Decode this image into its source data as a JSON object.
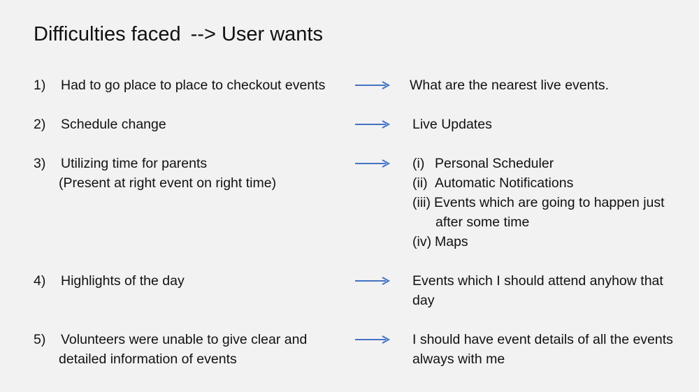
{
  "slide": {
    "title_left": "Difficulties faced",
    "title_arrow": "-->",
    "title_right": "User wants",
    "accent_color": "#4472c4",
    "rows": [
      {
        "num": "1)",
        "left": [
          "Had to go place to place to checkout events"
        ],
        "right": [
          "What are the nearest live events."
        ]
      },
      {
        "num": "2)",
        "left": [
          "Schedule change"
        ],
        "right": [
          "Live Updates"
        ]
      },
      {
        "num": "3)",
        "left": [
          "Utilizing time for parents",
          "(Present at right event on right time)"
        ],
        "right_items": [
          {
            "mark": "(i)",
            "text": "Personal Scheduler"
          },
          {
            "mark": "(ii)",
            "text": "Automatic Notifications"
          },
          {
            "mark": "(iii)",
            "text": "Events which are going to happen just"
          },
          {
            "mark": "",
            "text": "after some time"
          },
          {
            "mark": "(iv)",
            "text": "Maps"
          }
        ]
      },
      {
        "num": "4)",
        "left": [
          "Highlights of the day"
        ],
        "right": [
          "Events which I should attend anyhow that",
          "day"
        ]
      },
      {
        "num": "5)",
        "left": [
          "Volunteers were unable to give clear and",
          "detailed information of events"
        ],
        "right": [
          "I should have event details of all the events",
          "always with me"
        ]
      }
    ]
  }
}
